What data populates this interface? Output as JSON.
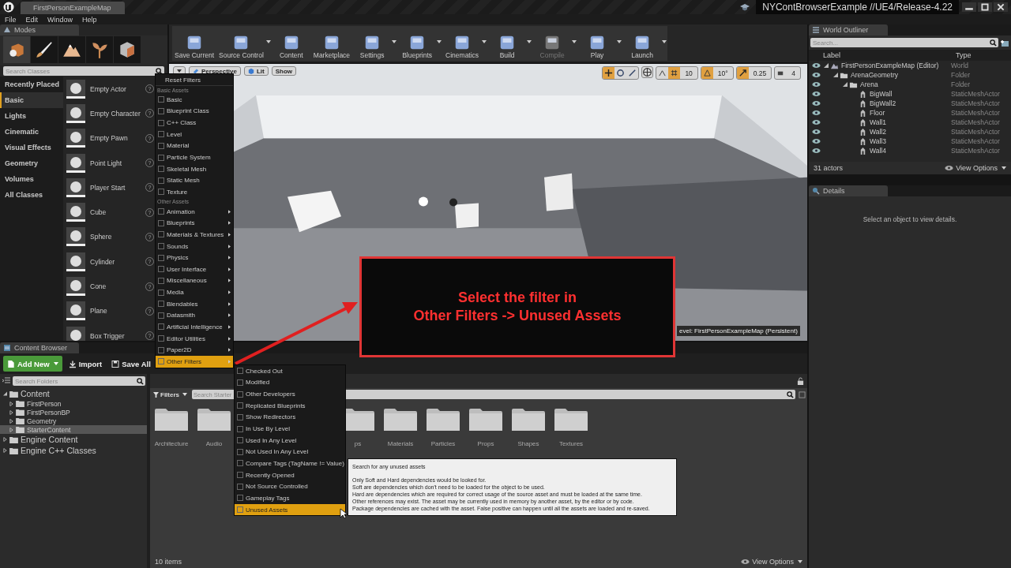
{
  "title_bar": {
    "tab": "FirstPersonExampleMap",
    "project": "NYContBrowserExample //UE4/Release-4.22"
  },
  "menu": [
    "File",
    "Edit",
    "Window",
    "Help"
  ],
  "modes": {
    "title": "Modes",
    "tabs": [
      {
        "selected": true
      },
      {
        "selected": false
      },
      {
        "selected": false
      },
      {
        "selected": false
      },
      {
        "selected": false
      }
    ],
    "search": {
      "placeholder": "Search Classes"
    },
    "categories": [
      {
        "label": "Recently Placed",
        "selected": false
      },
      {
        "label": "Basic",
        "selected": true
      },
      {
        "label": "Lights",
        "selected": false
      },
      {
        "label": "Cinematic",
        "selected": false
      },
      {
        "label": "Visual Effects",
        "selected": false
      },
      {
        "label": "Geometry",
        "selected": false
      },
      {
        "label": "Volumes",
        "selected": false
      },
      {
        "label": "All Classes",
        "selected": false
      }
    ],
    "items": [
      {
        "label": "Empty Actor",
        "help": "?"
      },
      {
        "label": "Empty Character",
        "help": "?"
      },
      {
        "label": "Empty Pawn",
        "help": "?"
      },
      {
        "label": "Point Light",
        "help": "?"
      },
      {
        "label": "Player Start",
        "help": "?"
      },
      {
        "label": "Cube",
        "help": "?"
      },
      {
        "label": "Sphere",
        "help": "?"
      },
      {
        "label": "Cylinder",
        "help": "?"
      },
      {
        "label": "Cone",
        "help": "?"
      },
      {
        "label": "Plane",
        "help": "?"
      },
      {
        "label": "Box Trigger",
        "help": "?"
      }
    ]
  },
  "toolbar": [
    {
      "label": "Save Current",
      "dropdown": false,
      "disabled": false
    },
    {
      "label": "Source Control",
      "dropdown": true,
      "disabled": false
    },
    {
      "label": "Content",
      "dropdown": false,
      "disabled": false
    },
    {
      "label": "Marketplace",
      "dropdown": false,
      "disabled": false
    },
    {
      "label": "Settings",
      "dropdown": true,
      "disabled": false
    },
    {
      "label": "Blueprints",
      "dropdown": true,
      "disabled": false
    },
    {
      "label": "Cinematics",
      "dropdown": true,
      "disabled": false
    },
    {
      "label": "Build",
      "dropdown": true,
      "disabled": false
    },
    {
      "label": "Compile",
      "dropdown": true,
      "disabled": true
    },
    {
      "label": "Play",
      "dropdown": true,
      "disabled": false
    },
    {
      "label": "Launch",
      "dropdown": true,
      "disabled": false
    }
  ],
  "viewport": {
    "view": "Perspective",
    "lit": "Lit",
    "show": "Show",
    "grid": "10",
    "angle": "10°",
    "scale": "0.25",
    "speed": "4",
    "level": "evel:  FirstPersonExampleMap (Persistent)"
  },
  "callout": {
    "lines": [
      "Select the filter in",
      "Other Filters -> Unused Assets"
    ]
  },
  "filter_menu": {
    "reset": "Reset Filters",
    "sections": [
      {
        "heading": "Basic Assets",
        "items": [
          {
            "label": "Basic",
            "checked": false,
            "submenu": false,
            "selected": false
          },
          {
            "label": "Blueprint Class",
            "checked": false,
            "submenu": false,
            "selected": false
          },
          {
            "label": "C++ Class",
            "checked": false,
            "submenu": false,
            "selected": false
          },
          {
            "label": "Level",
            "checked": false,
            "submenu": false,
            "selected": false
          },
          {
            "label": "Material",
            "checked": false,
            "submenu": false,
            "selected": false
          },
          {
            "label": "Particle System",
            "checked": false,
            "submenu": false,
            "selected": false
          },
          {
            "label": "Skeletal Mesh",
            "checked": false,
            "submenu": false,
            "selected": false
          },
          {
            "label": "Static Mesh",
            "checked": false,
            "submenu": false,
            "selected": false
          },
          {
            "label": "Texture",
            "checked": false,
            "submenu": false,
            "selected": false
          }
        ]
      },
      {
        "heading": "Other Assets",
        "items": [
          {
            "label": "Animation",
            "checked": false,
            "submenu": true,
            "selected": false
          },
          {
            "label": "Blueprints",
            "checked": false,
            "submenu": true,
            "selected": false
          },
          {
            "label": "Materials & Textures",
            "checked": false,
            "submenu": true,
            "selected": false
          },
          {
            "label": "Sounds",
            "checked": false,
            "submenu": true,
            "selected": false
          },
          {
            "label": "Physics",
            "checked": false,
            "submenu": true,
            "selected": false
          },
          {
            "label": "User Interface",
            "checked": false,
            "submenu": true,
            "selected": false
          },
          {
            "label": "Miscellaneous",
            "checked": false,
            "submenu": true,
            "selected": false
          },
          {
            "label": "Media",
            "checked": false,
            "submenu": true,
            "selected": false
          },
          {
            "label": "Blendables",
            "checked": false,
            "submenu": true,
            "selected": false
          },
          {
            "label": "Datasmith",
            "checked": false,
            "submenu": true,
            "selected": false
          },
          {
            "label": "Artificial Intelligence",
            "checked": false,
            "submenu": true,
            "selected": false
          },
          {
            "label": "Editor Utilities",
            "checked": false,
            "submenu": true,
            "selected": false
          },
          {
            "label": "Paper2D",
            "checked": false,
            "submenu": true,
            "selected": false
          },
          {
            "label": "Other Filters",
            "checked": false,
            "submenu": true,
            "selected": true
          }
        ]
      }
    ]
  },
  "submenu": [
    {
      "label": "Checked Out",
      "checked": false,
      "selected": false
    },
    {
      "label": "Modified",
      "checked": false,
      "selected": false
    },
    {
      "label": "Other Developers",
      "checked": false,
      "selected": false
    },
    {
      "label": "Replicated Blueprints",
      "checked": false,
      "selected": false
    },
    {
      "label": "Show Redirectors",
      "checked": false,
      "selected": false
    },
    {
      "label": "In Use By Level",
      "checked": false,
      "selected": false
    },
    {
      "label": "Used In Any Level",
      "checked": false,
      "selected": false
    },
    {
      "label": "Not Used In Any Level",
      "checked": false,
      "selected": false
    },
    {
      "label": "Compare Tags (TagName != Value)",
      "checked": false,
      "selected": false
    },
    {
      "label": "Recently Opened",
      "checked": false,
      "selected": false
    },
    {
      "label": "Not Source Controlled",
      "checked": false,
      "selected": false
    },
    {
      "label": "Gameplay Tags",
      "checked": false,
      "selected": false
    },
    {
      "label": "Unused Assets",
      "checked": false,
      "selected": true
    }
  ],
  "tooltip": {
    "title": "Search for any unused assets",
    "lines": [
      "Only Soft and Hard dependencies would be looked for.",
      "Soft are dependencies which don't need to be loaded for the object to be used.",
      "Hard are dependencies which are required for correct usage of the source asset and must be loaded at the same time.",
      "Other references may exist. The asset may be currently used in memory by another asset, by the editor or by code.",
      "Package dependencies are cached with the asset. False positive can happen until all the assets are loaded and re-saved."
    ]
  },
  "world_outliner": {
    "title": "World Outliner",
    "search": {
      "placeholder": "Search..."
    },
    "columns": [
      "Label",
      "Type"
    ],
    "tree": [
      {
        "label": "FirstPersonExampleMap (Editor)",
        "type": "World",
        "kind": "world",
        "expanded": true,
        "children": [
          {
            "label": "ArenaGeometry",
            "type": "Folder",
            "kind": "folder",
            "expanded": true,
            "children": [
              {
                "label": "Arena",
                "type": "Folder",
                "kind": "folder",
                "expanded": true,
                "children": [
                  {
                    "label": "BigWall",
                    "type": "StaticMeshActor",
                    "kind": "mesh"
                  },
                  {
                    "label": "BigWall2",
                    "type": "StaticMeshActor",
                    "kind": "mesh"
                  },
                  {
                    "label": "Floor",
                    "type": "StaticMeshActor",
                    "kind": "mesh"
                  },
                  {
                    "label": "Wall1",
                    "type": "StaticMeshActor",
                    "kind": "mesh"
                  },
                  {
                    "label": "Wall2",
                    "type": "StaticMeshActor",
                    "kind": "mesh"
                  },
                  {
                    "label": "Wall3",
                    "type": "StaticMeshActor",
                    "kind": "mesh"
                  },
                  {
                    "label": "Wall4",
                    "type": "StaticMeshActor",
                    "kind": "mesh"
                  }
                ]
              }
            ]
          }
        ]
      }
    ],
    "count": "31 actors",
    "view_options": "View Options"
  },
  "details": {
    "title": "Details",
    "message": "Select an object to view details."
  },
  "content_browser": {
    "title": "Content Browser",
    "add_new": "Add New",
    "import": "Import",
    "save_all": "Save All",
    "folder_search": {
      "placeholder": "Search Folders"
    },
    "tree": [
      {
        "label": "Content",
        "expanded": true,
        "selected": false,
        "children": [
          {
            "label": "FirstPerson",
            "expanded": false,
            "selected": false
          },
          {
            "label": "FirstPersonBP",
            "expanded": false,
            "selected": false
          },
          {
            "label": "Geometry",
            "expanded": false,
            "selected": false
          },
          {
            "label": "StarterContent",
            "expanded": false,
            "selected": true
          }
        ]
      },
      {
        "label": "Engine Content",
        "expanded": false,
        "selected": false
      },
      {
        "label": "Engine C++ Classes",
        "expanded": false,
        "selected": false
      }
    ],
    "filters": "Filters",
    "asset_search": {
      "placeholder": "Search Starter"
    },
    "folders_left": [
      "Architecture",
      "Audio"
    ],
    "folders_right": [
      "ps",
      "Materials",
      "Particles",
      "Props",
      "Shapes",
      "Textures"
    ],
    "count": "10 items",
    "view_options": "View Options"
  }
}
